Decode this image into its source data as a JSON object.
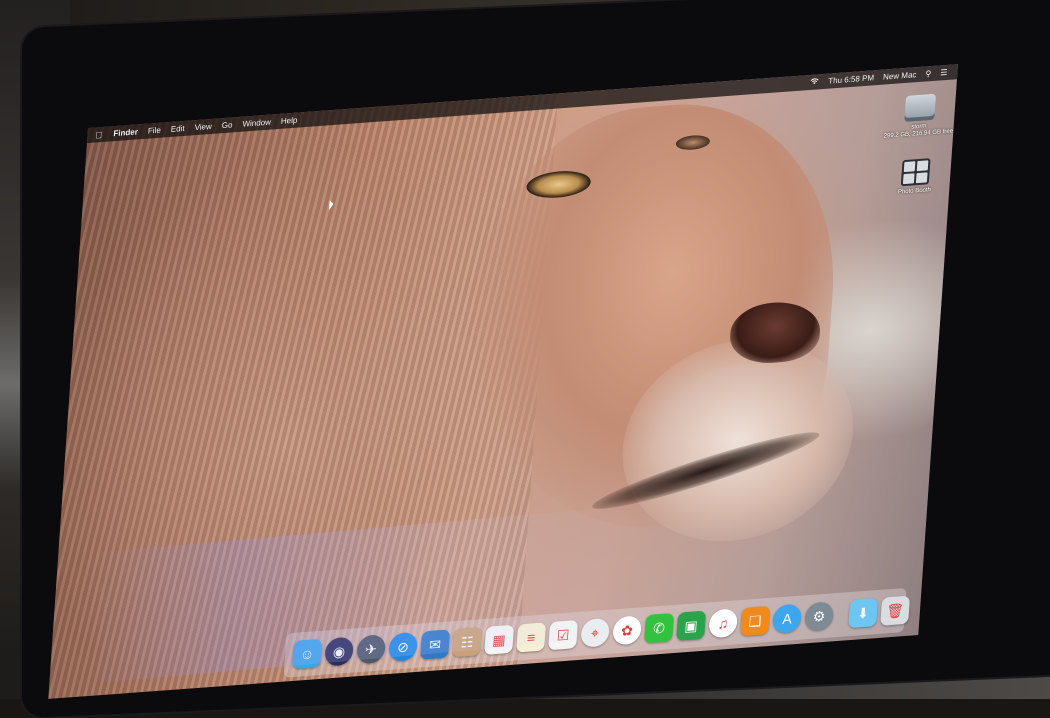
{
  "menubar": {
    "app_name": "Finder",
    "items": [
      "File",
      "Edit",
      "View",
      "Go",
      "Window",
      "Help"
    ],
    "clock": "Thu 6:58 PM",
    "user": "New Mac"
  },
  "desktop_icons": [
    {
      "name": "storm",
      "detail": "299.2 GB, 216.94 GB free",
      "icon": "hard-drive-icon"
    },
    {
      "name": "Photo Booth",
      "detail": "",
      "icon": "photo-booth-icon"
    }
  ],
  "dock": {
    "apps": [
      {
        "icon": "finder-icon",
        "bg": "#3da7e8",
        "glyph": "☺"
      },
      {
        "icon": "siri-icon",
        "bg": "#2b2d5a",
        "glyph": "◉"
      },
      {
        "icon": "launchpad-icon",
        "bg": "#4c5767",
        "glyph": "✈"
      },
      {
        "icon": "safari-icon",
        "bg": "#1e88e5",
        "glyph": "⊘"
      },
      {
        "icon": "mail-icon",
        "bg": "#2f79c9",
        "glyph": "✉"
      },
      {
        "icon": "contacts-icon",
        "bg": "#c9a27a",
        "glyph": "☷"
      },
      {
        "icon": "calendar-icon",
        "bg": "#f4f4f4",
        "glyph": "▦"
      },
      {
        "icon": "notes-icon",
        "bg": "#f5f0d5",
        "glyph": "≡"
      },
      {
        "icon": "reminders-icon",
        "bg": "#f4f4f4",
        "glyph": "☑"
      },
      {
        "icon": "maps-icon",
        "bg": "#eaeef0",
        "glyph": "⌖"
      },
      {
        "icon": "photos-icon",
        "bg": "#ffffff",
        "glyph": "✿"
      },
      {
        "icon": "messages-icon",
        "bg": "#33c23f",
        "glyph": "✆"
      },
      {
        "icon": "facetime-icon",
        "bg": "#2ba34a",
        "glyph": "▣"
      },
      {
        "icon": "itunes-icon",
        "bg": "#ffffff",
        "glyph": "♫"
      },
      {
        "icon": "ibooks-icon",
        "bg": "#f08a1c",
        "glyph": "❑"
      },
      {
        "icon": "app-store-icon",
        "bg": "#3ca7ef",
        "glyph": "A"
      },
      {
        "icon": "system-preferences-icon",
        "bg": "#7e8a94",
        "glyph": "⚙"
      }
    ],
    "extras": [
      {
        "icon": "downloads-folder-icon",
        "bg": "#6cc6ef",
        "glyph": "⬇"
      },
      {
        "icon": "trash-icon",
        "bg": "#d9dde0",
        "glyph": "🗑"
      }
    ]
  },
  "colors": {
    "bezel": "#0b0b0d",
    "menubar_bg": "#141212",
    "wallpaper_mane": "#b8826a",
    "wallpaper_face": "#d8a48a"
  }
}
